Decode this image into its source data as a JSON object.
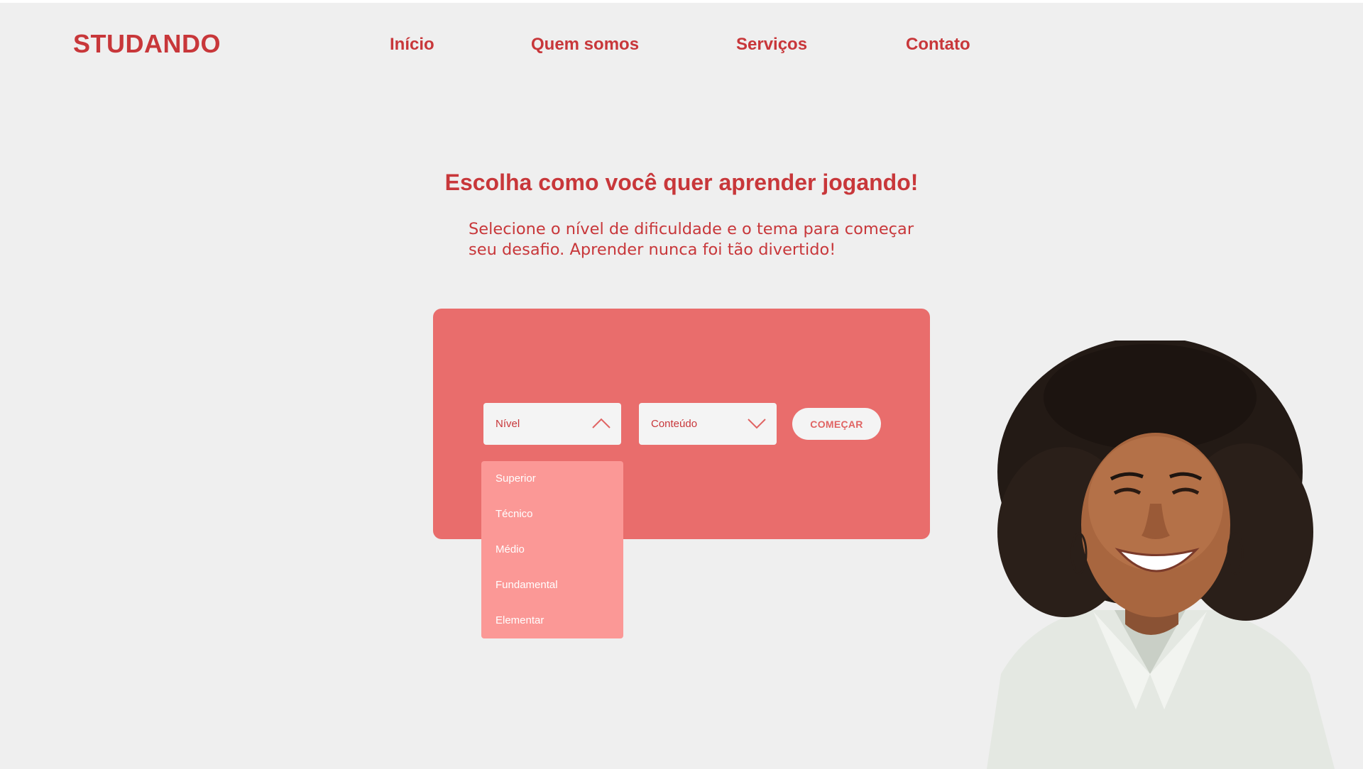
{
  "brand": {
    "logo": "STUDANDO",
    "accent_color": "#c8373a"
  },
  "nav": {
    "items": [
      "Início",
      "Quem somos",
      "Serviços",
      "Contato"
    ]
  },
  "hero": {
    "headline": "Escolha como você quer aprender jogando!",
    "subtext_line1": "Selecione o nível de dificuldade e o tema para começar",
    "subtext_line2": "seu desafio. Aprender nunca foi tão divertido!"
  },
  "form": {
    "level_select": {
      "label": "Nível",
      "state": "open",
      "icon": "chevron-up-icon"
    },
    "content_select": {
      "label": "Conteúdo",
      "state": "closed",
      "icon": "chevron-down-icon"
    },
    "start_button": "COMEÇAR",
    "level_options": [
      "Superior",
      "Técnico",
      "Médio",
      "Fundamental",
      "Elementar"
    ]
  },
  "colors": {
    "background": "#efefef",
    "panel": "#e96d6c",
    "dropdown": "#fb9896",
    "field": "#f4f4f4"
  },
  "image": {
    "icon": "smiling-woman-photo"
  }
}
